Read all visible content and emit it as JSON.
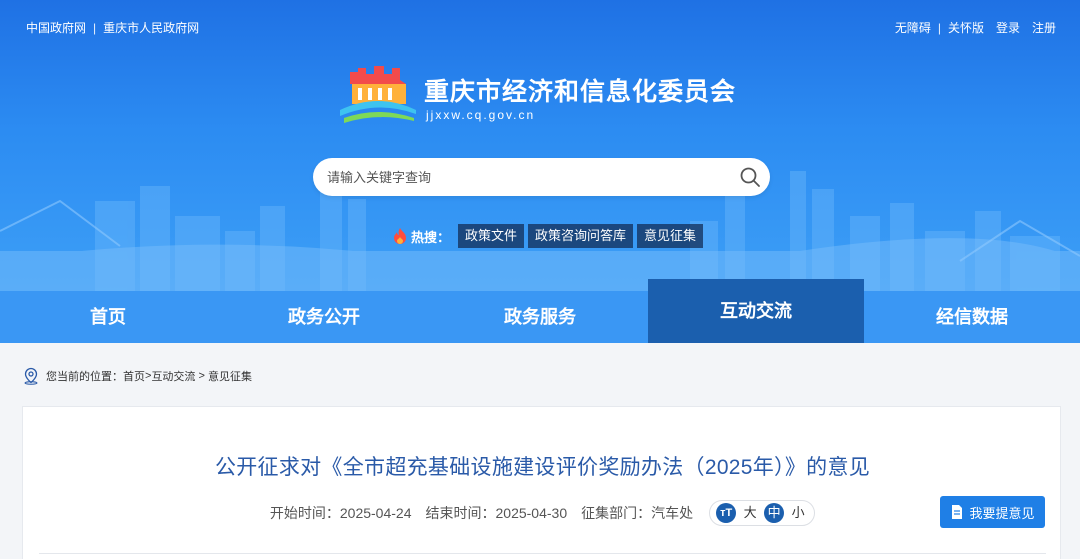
{
  "top_bar": {
    "left_links": [
      "中国政府网",
      "重庆市人民政府网"
    ],
    "right_links": [
      "无障碍",
      "关怀版",
      "登录",
      "注册"
    ]
  },
  "brand": {
    "title": "重庆市经济和信息化委员会",
    "domain": "jjxxw.cq.gov.cn"
  },
  "search": {
    "placeholder": "请输入关键字查询",
    "value": ""
  },
  "hot": {
    "label": "热搜：",
    "tags": [
      "政策文件",
      "政策咨询问答库",
      "意见征集"
    ]
  },
  "nav": {
    "items": [
      "首页",
      "政务公开",
      "政务服务",
      "互动交流",
      "经信数据"
    ],
    "active_index": 3
  },
  "breadcrumb": {
    "prefix": "您当前的位置：",
    "home": "首页",
    "sep": ">",
    "level1": "互动交流",
    "level2": "意见征集"
  },
  "article": {
    "title": "公开征求对《全市超充基础设施建设评价奖励办法（2025年）》的意见",
    "start": "开始时间：2025-04-24",
    "end": "结束时间：2025-04-30",
    "dept": "征集部门：汽车处",
    "font_sizes": [
      "大",
      "中",
      "小"
    ],
    "font_selected": "中"
  },
  "suggest_button": "我要提意见",
  "colors": {
    "header_blue": "#2c8cf2",
    "nav_blue": "#3a97f4",
    "nav_active": "#1b5fae",
    "title_blue": "#2a5aa8",
    "button_blue": "#1f7fe6"
  }
}
